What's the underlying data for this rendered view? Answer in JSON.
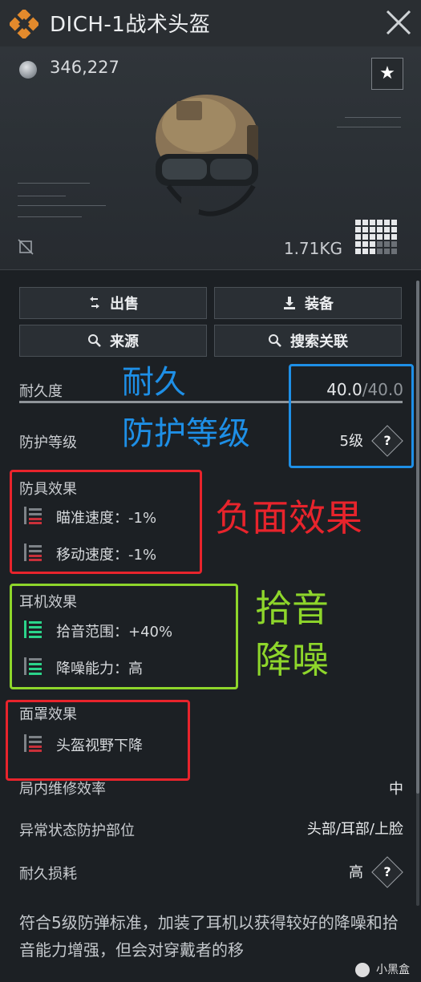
{
  "header": {
    "title": "DICH-1战术头盔"
  },
  "item": {
    "price": "346,227",
    "weight": "1.71KG"
  },
  "actions": {
    "sell": "出售",
    "equip": "装备",
    "source": "来源",
    "search_related": "搜索关联"
  },
  "durability": {
    "label": "耐久度",
    "current": "40.0",
    "max": "/40.0"
  },
  "protection": {
    "label": "防护等级",
    "value": "5级"
  },
  "armor_effects": {
    "title": "防具效果",
    "items": [
      "瞄准速度：-1%",
      "移动速度：-1%"
    ]
  },
  "headset_effects": {
    "title": "耳机效果",
    "items": [
      "拾音范围：+40%",
      "降噪能力：高"
    ]
  },
  "mask_effects": {
    "title": "面罩效果",
    "items": [
      "头盔视野下降"
    ]
  },
  "stats": {
    "repair": {
      "label": "局内维修效率",
      "value": "中"
    },
    "zones": {
      "label": "异常状态防护部位",
      "value": "头部/耳部/上脸"
    },
    "wear": {
      "label": "耐久损耗",
      "value": "高"
    }
  },
  "description": "符合5级防弹标准，加装了耳机以获得较好的降噪和拾音能力增强，但会对穿戴者的移",
  "annotations": {
    "durability": "耐久",
    "protection": "防护等级",
    "negative": "负面效果",
    "pickup": "拾音",
    "noise": "降噪"
  },
  "colors": {
    "blue": "#1e8fe6",
    "red": "#e8242c",
    "green": "#8ed62b",
    "positive": "#2bd48a",
    "negative": "#c9303a"
  },
  "watermark": "小黑盒"
}
